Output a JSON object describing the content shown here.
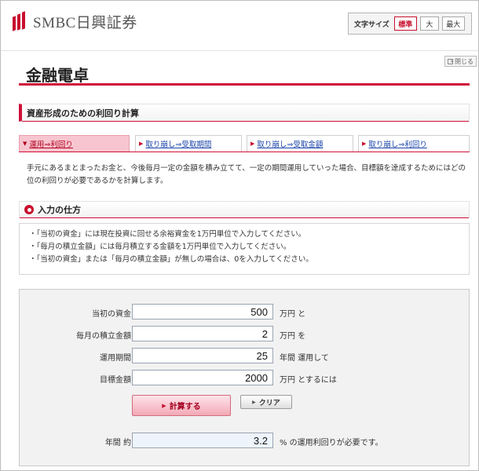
{
  "header": {
    "brand": "SMBC日興証券",
    "font_size_label": "文字サイズ",
    "font_sizes": [
      "標準",
      "大",
      "最大"
    ],
    "close_label": "閉じる"
  },
  "page_title": "金融電卓",
  "section_title": "資産形成のための利回り計算",
  "tabs": [
    {
      "label": "運用⇒利回り",
      "active": true
    },
    {
      "label": "取り崩し⇒受取期間",
      "active": false
    },
    {
      "label": "取り崩し⇒受取金額",
      "active": false
    },
    {
      "label": "取り崩し⇒利回り",
      "active": false
    }
  ],
  "description": "手元にあるまとまったお金と、今後毎月一定の金額を積み立てて、一定の期間運用していった場合、目標額を達成するためにはどの位の利回りが必要であるかを計算します。",
  "howto": {
    "title": "入力の仕方",
    "notes": [
      "・「当初の資金」には現在投資に回せる余裕資金を1万円単位で入力してください。",
      "・「毎月の積立金額」には毎月積立する金額を1万円単位で入力してください。",
      "・「当初の資金」または「毎月の積立金額」が無しの場合は、0を入力してください。"
    ]
  },
  "calculator": {
    "rows": [
      {
        "label": "当初の資金",
        "value": "500",
        "unit": "万円 と"
      },
      {
        "label": "毎月の積立金額",
        "value": "2",
        "unit": "万円 を"
      },
      {
        "label": "運用期間",
        "value": "25",
        "unit": "年間 運用して"
      },
      {
        "label": "目標金額",
        "value": "2000",
        "unit": "万円 とするには"
      }
    ],
    "calc_button": "計算する",
    "clear_button": "クリア",
    "result_label": "年間 約",
    "result_value": "3.2",
    "result_unit": "% の運用利回りが必要です。"
  },
  "colors": {
    "accent": "#d0103a",
    "tab_active_bg": "#f7c5cf",
    "link": "#1a44a8"
  }
}
